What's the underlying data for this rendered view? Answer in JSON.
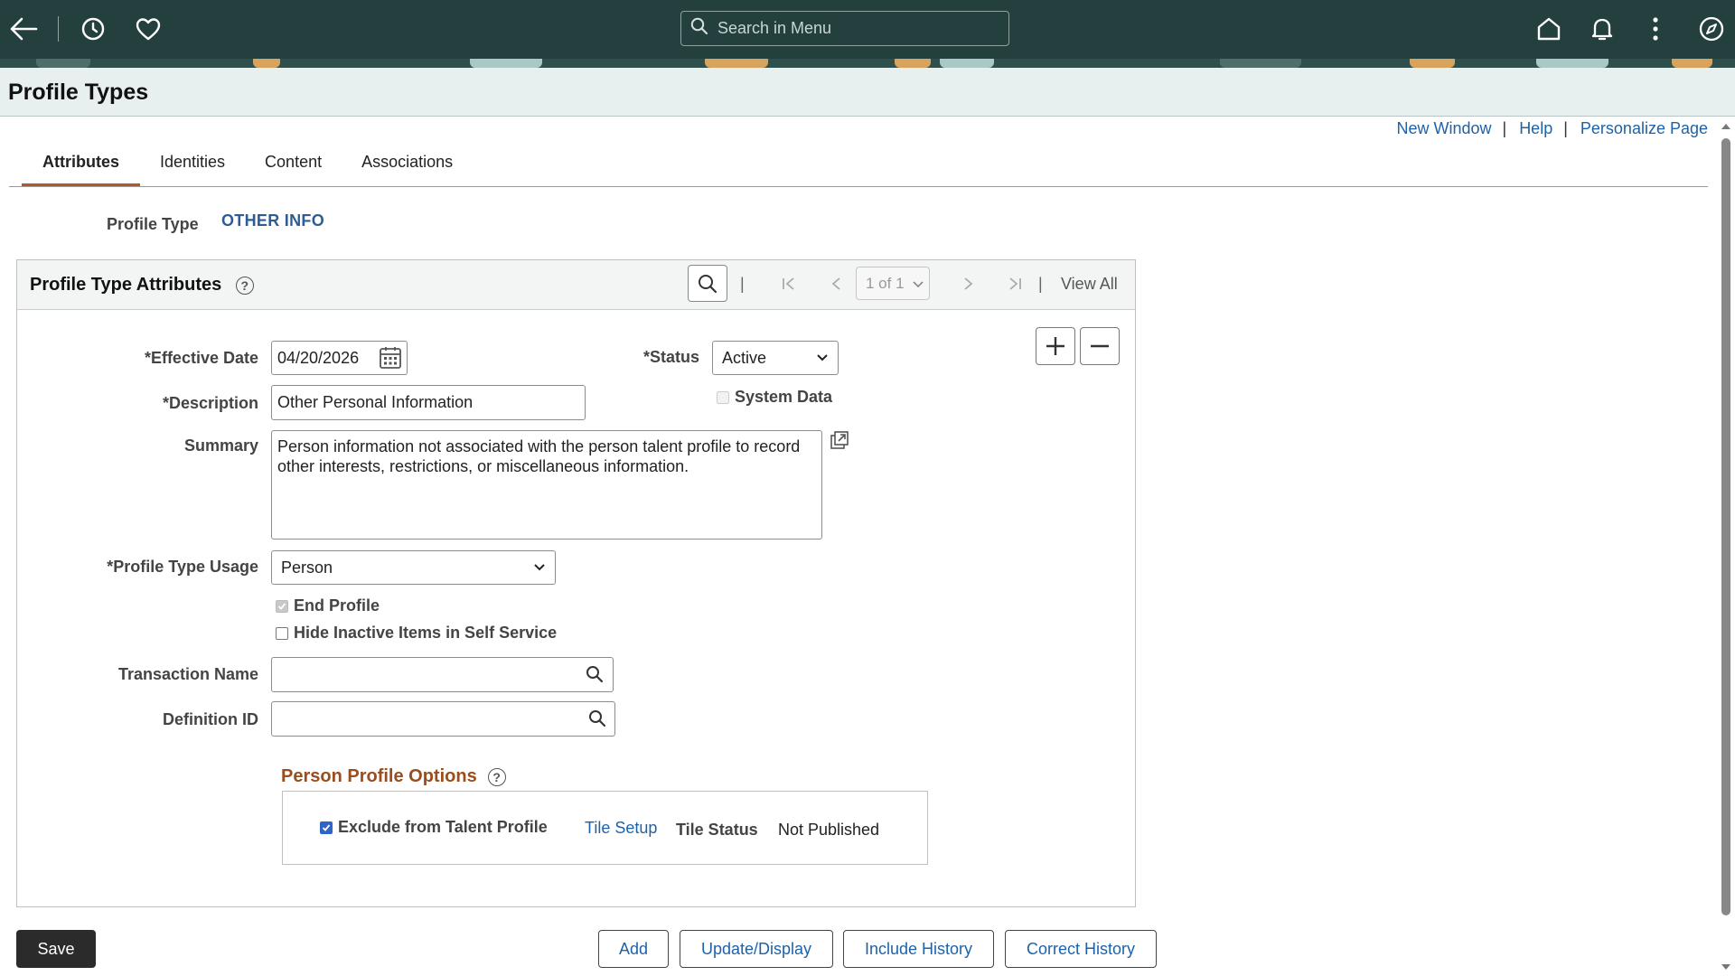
{
  "topbar": {
    "search_placeholder": "Search in Menu"
  },
  "page": {
    "title": "Profile Types"
  },
  "links": {
    "new_window": "New Window",
    "help": "Help",
    "personalize": "Personalize Page",
    "separator": "|"
  },
  "tabs": [
    {
      "label": "Attributes",
      "active": true
    },
    {
      "label": "Identities",
      "active": false
    },
    {
      "label": "Content",
      "active": false
    },
    {
      "label": "Associations",
      "active": false
    }
  ],
  "profile_type": {
    "label": "Profile Type",
    "value": "OTHER INFO"
  },
  "group": {
    "title": "Profile Type Attributes",
    "help": "?",
    "pager": "1 of 1",
    "view_all": "View All",
    "separator": "|"
  },
  "form": {
    "effective_date_label": "*Effective Date",
    "effective_date_value": "04/20/2026",
    "status_label": "*Status",
    "status_value": "Active",
    "system_data_label": "System Data",
    "description_label": "*Description",
    "description_value": "Other Personal Information",
    "summary_label": "Summary",
    "summary_value": "Person information not associated with the person talent profile to record other interests, restrictions, or miscellaneous information.",
    "usage_label": "*Profile Type Usage",
    "usage_value": "Person",
    "end_profile_label": "End Profile",
    "hide_inactive_label": "Hide Inactive Items in Self Service",
    "transaction_name_label": "Transaction Name",
    "transaction_name_value": "",
    "definition_id_label": "Definition ID",
    "definition_id_value": ""
  },
  "person_options": {
    "title": "Person Profile Options",
    "help": "?",
    "exclude_label": "Exclude from Talent Profile",
    "tile_setup": "Tile Setup",
    "tile_status_label": "Tile Status",
    "tile_status_value": "Not Published"
  },
  "buttons": {
    "save": "Save",
    "add": "Add",
    "update_display": "Update/Display",
    "include_history": "Include History",
    "correct_history": "Correct History"
  },
  "colors": {
    "topbar": "#23403f",
    "accent_tab": "#b05a2b",
    "link": "#1d62a8",
    "section_title": "#9a4d1d"
  }
}
